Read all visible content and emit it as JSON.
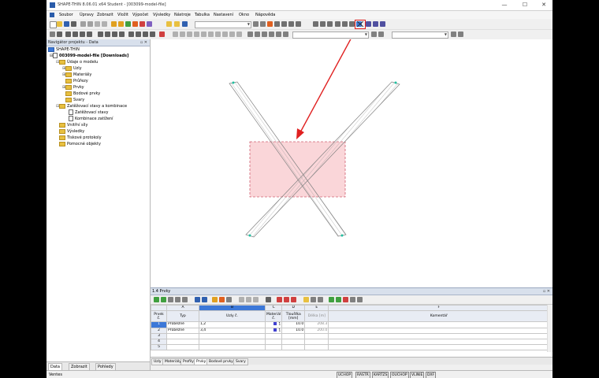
{
  "window": {
    "title": "SHAPE-THIN 8.06.01 x64 Student - [003099-model-file]",
    "minimize": "—",
    "maximize": "☐",
    "close": "✕"
  },
  "menu": [
    "Soubor",
    "Úpravy",
    "Zobrazit",
    "Vložit",
    "Výpočet",
    "Výsledky",
    "Nástroje",
    "Tabulka",
    "Nastavení",
    "Okno",
    "Nápověda"
  ],
  "navigator": {
    "title": "Navigátor projektu - Data",
    "controls": "▫ ✕",
    "root": "SHAPE-THIN",
    "model": "003099-model-file [Downloads]",
    "items": [
      {
        "label": "Údaje o modelu",
        "level": 2,
        "kind": "folder"
      },
      {
        "label": "Uzly",
        "level": 3,
        "kind": "folder"
      },
      {
        "label": "Materiály",
        "level": 3,
        "kind": "folder"
      },
      {
        "label": "Průřezy",
        "level": 3,
        "kind": "folder"
      },
      {
        "label": "Prvky",
        "level": 3,
        "kind": "folder"
      },
      {
        "label": "Bodové prvky",
        "level": 3,
        "kind": "folder"
      },
      {
        "label": "Svary",
        "level": 3,
        "kind": "folder"
      },
      {
        "label": "Zatěžovací stavy a kombinace",
        "level": 2,
        "kind": "folder"
      },
      {
        "label": "Zatěžovací stavy",
        "level": 3,
        "kind": "doc"
      },
      {
        "label": "Kombinace zatížení",
        "level": 3,
        "kind": "doc"
      },
      {
        "label": "Vnitřní síly",
        "level": 2,
        "kind": "folder"
      },
      {
        "label": "Výsledky",
        "level": 2,
        "kind": "folder"
      },
      {
        "label": "Tiskové protokoly",
        "level": 2,
        "kind": "folder"
      },
      {
        "label": "Pomocné objekty",
        "level": 2,
        "kind": "folder"
      }
    ],
    "tabs": [
      "Data",
      "Zobrazit",
      "Pohledy"
    ]
  },
  "table": {
    "title": "1.4 Prvky",
    "controls": "▫ ✕",
    "col_letters": [
      "A",
      "B",
      "C",
      "D",
      "E",
      "F"
    ],
    "headers": {
      "prvek": "Prvek č.",
      "typ": "Typ",
      "uzly": "Uzly č.",
      "material": "Materiál č.",
      "tloustka": "Tloušťka [mm]",
      "delka": "Délka [m]",
      "komentar": "Komentář"
    },
    "rows": [
      {
        "no": "1",
        "typ": "Průběžné",
        "uzly": "1,2",
        "mat": "1",
        "t": "10.0",
        "l": "208.3"
      },
      {
        "no": "2",
        "typ": "Průběžné",
        "uzly": "3,4",
        "mat": "1",
        "t": "10.0",
        "l": "200.0"
      },
      {
        "no": "3",
        "typ": "",
        "uzly": "",
        "mat": "",
        "t": "",
        "l": ""
      },
      {
        "no": "4",
        "typ": "",
        "uzly": "",
        "mat": "",
        "t": "",
        "l": ""
      },
      {
        "no": "5",
        "typ": "",
        "uzly": "",
        "mat": "",
        "t": "",
        "l": ""
      }
    ],
    "tabs": [
      "Uzly",
      "Materiály",
      "Profily",
      "Prvky",
      "Bodové prvky",
      "Svary"
    ]
  },
  "status": {
    "text": "Ventes",
    "buttons": [
      "UCHOP",
      "RASTR",
      "KARTZS",
      "OUCHOP",
      "VLINIE",
      "DXF"
    ]
  },
  "colors": {
    "accent": "#2a5caa",
    "highlight": "#e02020",
    "rect_fill": "#f8c8cc",
    "rect_border": "#d06070",
    "member": "#909090",
    "node": "#20c0a0"
  },
  "icons": {
    "highlighted_tool": "cross-delete-icon",
    "arrow": "red-arrow-annotation"
  }
}
